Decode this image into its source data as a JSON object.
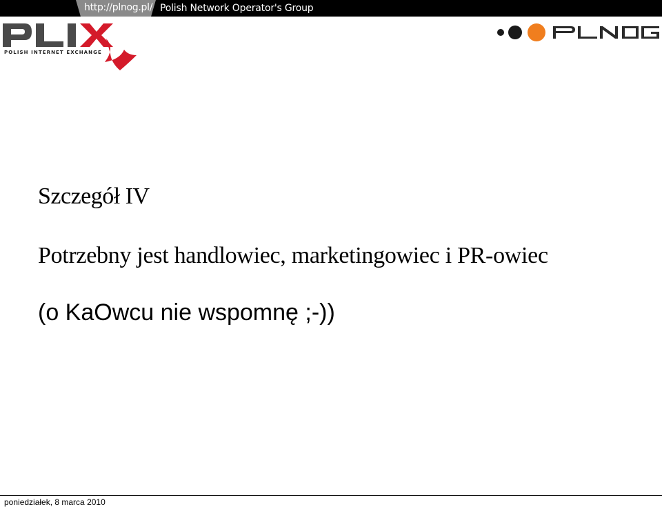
{
  "header": {
    "url": "http://plnog.pl/",
    "group_name": "Polish Network Operator's Group"
  },
  "logos": {
    "plix_subtitle": "POLISH INTERNET EXCHANGE",
    "plix_color": "#d41a2a",
    "plnog_accent": "#f07e1e"
  },
  "slide": {
    "title": "Szczegół IV",
    "line1": "Potrzebny jest handlowiec, marketingowiec i PR-owiec",
    "line2": "(o KaOwcu nie wspomnę ;-))"
  },
  "footer": {
    "date": "poniedziałek, 8 marca 2010"
  }
}
